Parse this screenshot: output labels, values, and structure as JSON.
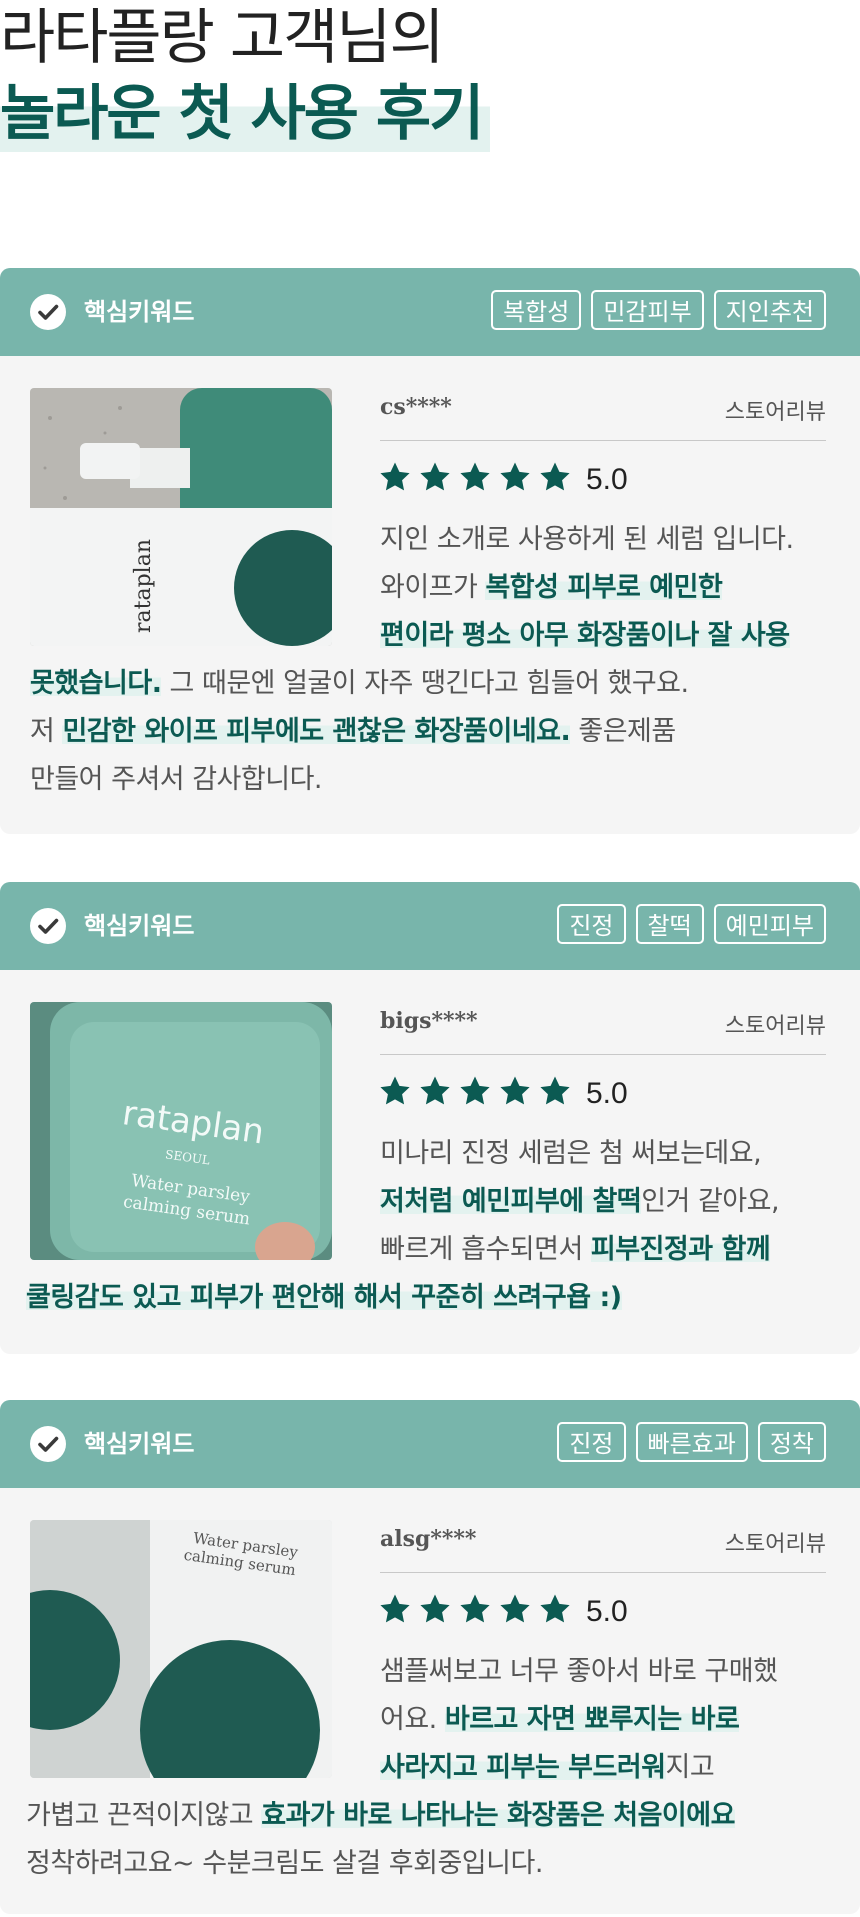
{
  "headline": {
    "line1": "라타플랑 고객님의",
    "line2": "놀라운 첫 사용 후기"
  },
  "colors": {
    "accent": "#0b5a52",
    "header": "#78b5ab",
    "highlight": "#e3f2ef",
    "card_bg": "#f5f5f5"
  },
  "reviews": [
    {
      "keyword_label": "핵심키워드",
      "tags": [
        "복합성",
        "민감피부",
        "지인추천"
      ],
      "user": "cs****",
      "source": "스토어리뷰",
      "rating": 5,
      "score": "5.0",
      "lines": [
        [
          {
            "t": "지인 소개로 사용하게 된 세럼 입니다.",
            "h": false
          }
        ],
        [
          {
            "t": "와이프가 ",
            "h": false
          },
          {
            "t": "복합성 피부로 예민한",
            "h": true
          }
        ],
        [
          {
            "t": "편이라 평소 아무 화장품이나 잘 사용",
            "h": true
          }
        ],
        [
          {
            "t": "못했습니다.",
            "h": true
          },
          {
            "t": " 그 때문엔 얼굴이 자주 땡긴다고 힘들어 했구요.",
            "h": false
          }
        ],
        [
          {
            "t": "저 ",
            "h": false
          },
          {
            "t": "민감한 와이프 피부에도 괜찮은 화장품이네요.",
            "h": true
          },
          {
            "t": " 좋은제품",
            "h": false
          }
        ],
        [
          {
            "t": "만들어 주셔서 감사합니다.",
            "h": false
          }
        ]
      ]
    },
    {
      "keyword_label": "핵심키워드",
      "tags": [
        "진정",
        "찰떡",
        "예민피부"
      ],
      "user": "bigs****",
      "source": "스토어리뷰",
      "rating": 5,
      "score": "5.0",
      "lines": [
        [
          {
            "t": "미나리 진정 세럼은 첨 써보는데요,",
            "h": false
          }
        ],
        [
          {
            "t": "저처럼 예민피부에 찰떡",
            "h": true
          },
          {
            "t": "인거 같아요,",
            "h": false
          }
        ],
        [
          {
            "t": "빠르게 흡수되면서 ",
            "h": false
          },
          {
            "t": "피부진정과 함께",
            "h": true
          }
        ],
        [
          {
            "t": "쿨링감도 있고 피부가 편안해 해서 꾸준히 쓰려구욥 :)",
            "h": true
          }
        ]
      ]
    },
    {
      "keyword_label": "핵심키워드",
      "tags": [
        "진정",
        "빠른효과",
        "정착"
      ],
      "user": "alsg****",
      "source": "스토어리뷰",
      "rating": 5,
      "score": "5.0",
      "lines": [
        [
          {
            "t": "샘플써보고 너무 좋아서 바로 구매했",
            "h": false
          }
        ],
        [
          {
            "t": "어요. ",
            "h": false
          },
          {
            "t": "바르고 자면 뾰루지는 바로",
            "h": true
          }
        ],
        [
          {
            "t": "사라지고 피부는 부드러워",
            "h": true
          },
          {
            "t": "지고",
            "h": false
          }
        ],
        [
          {
            "t": "가볍고 끈적이지않고 ",
            "h": false
          },
          {
            "t": "효과가 바로 나타나는 화장품은 처음이에요",
            "h": true
          }
        ],
        [
          {
            "t": "정착하려고요~ 수분크림도 살걸 후회중입니다.",
            "h": false
          }
        ]
      ]
    }
  ]
}
